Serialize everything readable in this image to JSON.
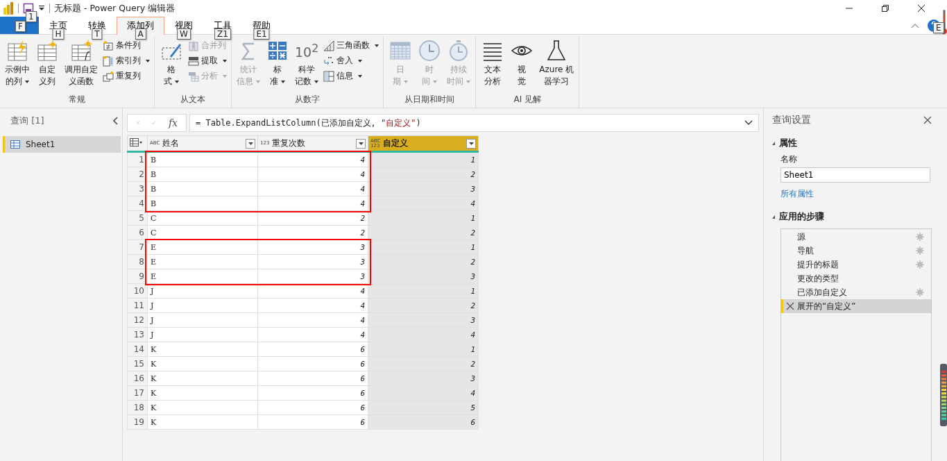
{
  "title_bar": {
    "title": "无标题 - Power Query 编辑器",
    "save_keytip": "1"
  },
  "tabs": [
    {
      "kind": "file",
      "keytip": "F",
      "selected": false
    },
    {
      "kind": "tab",
      "label": "主页",
      "keytip": "H",
      "selected": false
    },
    {
      "kind": "tab",
      "label": "转换",
      "keytip": "T",
      "selected": false
    },
    {
      "kind": "tab",
      "label": "添加列",
      "keytip": "A",
      "selected": true
    },
    {
      "kind": "tab",
      "label": "视图",
      "keytip": "W",
      "selected": false
    },
    {
      "kind": "tab",
      "label": "工具",
      "keytip": "Z1",
      "selected": false
    },
    {
      "kind": "tab",
      "label": "帮助",
      "keytip": "E1",
      "selected": false
    }
  ],
  "help_keytip": "E",
  "ribbon_groups": [
    {
      "label": "常规",
      "items": [
        {
          "kind": "large",
          "label_lines": [
            "示例中",
            "的列"
          ],
          "dropdown": true,
          "disabled": false
        },
        {
          "kind": "large",
          "label_lines": [
            "自定",
            "义列"
          ],
          "dropdown": false,
          "disabled": false
        },
        {
          "kind": "large",
          "label_lines": [
            "调用自定",
            "义函数"
          ],
          "dropdown": false,
          "disabled": false
        },
        {
          "kind": "stack",
          "items": [
            {
              "label": "条件列",
              "dropdown": false,
              "disabled": false
            },
            {
              "label": "索引列",
              "dropdown": true,
              "disabled": false
            },
            {
              "label": "重复列",
              "dropdown": false,
              "disabled": false
            }
          ]
        }
      ]
    },
    {
      "label": "从文本",
      "items": [
        {
          "kind": "large",
          "label_lines": [
            "格",
            "式"
          ],
          "dropdown": true,
          "disabled": false
        },
        {
          "kind": "stack",
          "items": [
            {
              "label": "合并列",
              "dropdown": false,
              "disabled": true
            },
            {
              "label": "提取",
              "dropdown": true,
              "disabled": false
            },
            {
              "label": "分析",
              "dropdown": true,
              "disabled": true
            }
          ]
        }
      ]
    },
    {
      "label": "从数字",
      "items": [
        {
          "kind": "large",
          "label_lines": [
            "统计",
            "信息"
          ],
          "dropdown": true,
          "disabled": true
        },
        {
          "kind": "large",
          "label_lines": [
            "标",
            "准"
          ],
          "dropdown": true,
          "disabled": false
        },
        {
          "kind": "large",
          "glyph": "10$^{2}$",
          "label_lines": [
            "科学",
            "记数"
          ],
          "dropdown": true,
          "disabled": false
        },
        {
          "kind": "stack",
          "items": [
            {
              "label": "三角函数",
              "dropdown": true,
              "disabled": false
            },
            {
              "label": "舍入",
              "dropdown": true,
              "disabled": false
            },
            {
              "label": "信息",
              "dropdown": true,
              "disabled": false
            }
          ]
        }
      ]
    },
    {
      "label": "从日期和时间",
      "items": [
        {
          "kind": "large",
          "label_lines": [
            "日",
            "期"
          ],
          "dropdown": true,
          "disabled": true
        },
        {
          "kind": "large",
          "label_lines": [
            "时",
            "间"
          ],
          "dropdown": true,
          "disabled": true
        },
        {
          "kind": "large",
          "label_lines": [
            "持续",
            "时间"
          ],
          "dropdown": true,
          "disabled": true
        }
      ]
    },
    {
      "label": "AI 见解",
      "items": [
        {
          "kind": "large",
          "label_lines": [
            "文本",
            "分析"
          ],
          "dropdown": false,
          "disabled": false
        },
        {
          "kind": "large",
          "label_lines": [
            "视",
            "觉"
          ],
          "dropdown": false,
          "disabled": false
        },
        {
          "kind": "large",
          "label_lines": [
            "Azure 机",
            "器学习"
          ],
          "dropdown": false,
          "disabled": false
        }
      ]
    }
  ],
  "queries_panel": {
    "title": "查询 [1]",
    "items": [
      {
        "label": "Sheet1",
        "selected": true
      }
    ]
  },
  "formula_bar": {
    "fx": "fx",
    "parts": [
      {
        "kind": "code",
        "text": "= Table.ExpandListColumn(已添加自定义, "
      },
      {
        "kind": "string",
        "text": "\"自定义\""
      },
      {
        "kind": "code",
        "text": ")"
      }
    ]
  },
  "table": {
    "columns": [
      {
        "name": "姓名",
        "type_glyph": [
          "ABC"
        ],
        "selected": false
      },
      {
        "name": "重复次数",
        "type_glyph": [
          "123"
        ],
        "selected": false
      },
      {
        "name": "自定义",
        "type_glyph": [
          "ABC",
          "123"
        ],
        "selected": true
      }
    ],
    "rows": [
      {
        "n": "1",
        "cells": [
          "B",
          "4",
          "1"
        ],
        "marked": true
      },
      {
        "n": "2",
        "cells": [
          "B",
          "4",
          "2"
        ],
        "marked": true
      },
      {
        "n": "3",
        "cells": [
          "B",
          "4",
          "3"
        ],
        "marked": true
      },
      {
        "n": "4",
        "cells": [
          "B",
          "4",
          "4"
        ],
        "marked": true
      },
      {
        "n": "5",
        "cells": [
          "C",
          "2",
          "1"
        ],
        "marked": false
      },
      {
        "n": "6",
        "cells": [
          "C",
          "2",
          "2"
        ],
        "marked": false
      },
      {
        "n": "7",
        "cells": [
          "E",
          "3",
          "1"
        ],
        "marked": true
      },
      {
        "n": "8",
        "cells": [
          "E",
          "3",
          "2"
        ],
        "marked": true
      },
      {
        "n": "9",
        "cells": [
          "E",
          "3",
          "3"
        ],
        "marked": true
      },
      {
        "n": "10",
        "cells": [
          "J",
          "4",
          "1"
        ],
        "marked": false
      },
      {
        "n": "11",
        "cells": [
          "J",
          "4",
          "2"
        ],
        "marked": false
      },
      {
        "n": "12",
        "cells": [
          "J",
          "4",
          "3"
        ],
        "marked": false
      },
      {
        "n": "13",
        "cells": [
          "J",
          "4",
          "4"
        ],
        "marked": false
      },
      {
        "n": "14",
        "cells": [
          "K",
          "6",
          "1"
        ],
        "marked": false
      },
      {
        "n": "15",
        "cells": [
          "K",
          "6",
          "2"
        ],
        "marked": false
      },
      {
        "n": "16",
        "cells": [
          "K",
          "6",
          "3"
        ],
        "marked": false
      },
      {
        "n": "17",
        "cells": [
          "K",
          "6",
          "4"
        ],
        "marked": false
      },
      {
        "n": "18",
        "cells": [
          "K",
          "6",
          "5"
        ],
        "marked": false
      },
      {
        "n": "19",
        "cells": [
          "K",
          "6",
          "6"
        ],
        "marked": false
      }
    ]
  },
  "settings_panel": {
    "title": "查询设置",
    "properties": {
      "heading": "属性",
      "expanded": true,
      "name_label": "名称",
      "name_value": "Sheet1",
      "link": "所有属性"
    },
    "steps": {
      "heading": "应用的步骤",
      "expanded": true,
      "items": [
        {
          "label": "源",
          "has_settings": true,
          "selected": false
        },
        {
          "label": "导航",
          "has_settings": true,
          "selected": false
        },
        {
          "label": "提升的标题",
          "has_settings": true,
          "selected": false
        },
        {
          "label": "更改的类型",
          "has_settings": false,
          "selected": false
        },
        {
          "label": "已添加自定义",
          "has_settings": true,
          "selected": false
        },
        {
          "label": "展开的“自定义”",
          "has_settings": false,
          "selected": true
        }
      ]
    }
  }
}
